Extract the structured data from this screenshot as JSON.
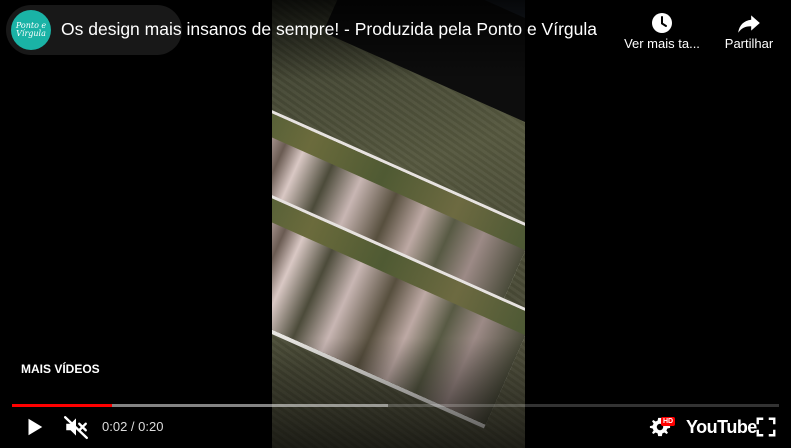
{
  "video": {
    "title": "Os design mais insanos de sempre! - Produzida pela Ponto e Vírgula",
    "channel_avatar_text": "Ponto e Vírgula"
  },
  "top_actions": {
    "watch_later_label": "Ver mais ta...",
    "share_label": "Partilhar"
  },
  "overlay": {
    "more_videos_label": "MAIS VÍDEOS"
  },
  "controls": {
    "current_time": "0:02",
    "duration": "0:20",
    "time_display": "0:02 / 0:20",
    "played_fraction": 0.13,
    "buffered_fraction": 0.49,
    "hd_badge": "HD",
    "logo_text": "YouTube"
  },
  "colors": {
    "progress_played": "#ff0000",
    "avatar_bg": "#1ab3a6"
  },
  "icons": {
    "play": "play-icon",
    "mute": "volume-muted-icon",
    "settings": "gear-icon",
    "fullscreen": "fullscreen-icon",
    "watch_later": "clock-icon",
    "share": "share-arrow-icon"
  }
}
